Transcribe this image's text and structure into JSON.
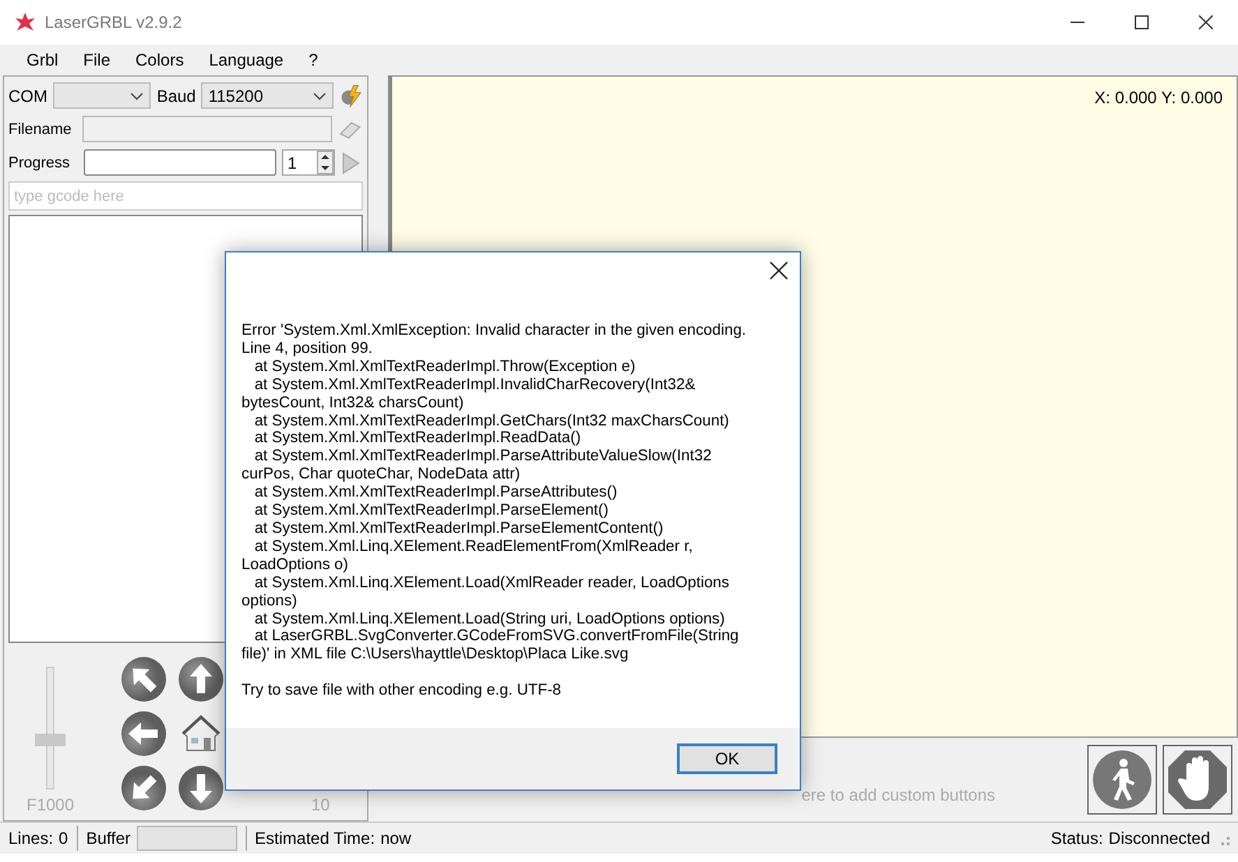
{
  "window": {
    "title": "LaserGRBL v2.9.2"
  },
  "menu": [
    "Grbl",
    "File",
    "Colors",
    "Language",
    "?"
  ],
  "connection": {
    "com_label": "COM",
    "baud_label": "Baud",
    "baud_value": "115200"
  },
  "file": {
    "filename_label": "Filename",
    "progress_label": "Progress",
    "passes": "1"
  },
  "gcode_field": {
    "placeholder": "type gcode here"
  },
  "progress": {
    "level": 0
  },
  "jog": {
    "speed": "F1000",
    "step": "10",
    "speed_slider": {
      "level": 0.4
    }
  },
  "canvas": {
    "coordinates": "X: 0.000 Y: 0.000"
  },
  "custom_buttons": {
    "hint": "ere to add custom buttons"
  },
  "status_bar": {
    "lines_label": "Lines:",
    "lines": "0",
    "buffer_label": "Buffer",
    "estimated_label": "Estimated Time:",
    "estimated": "now",
    "status_label": "Status:",
    "status": "Disconnected"
  },
  "dialog": {
    "message": [
      "Error 'System.Xml.XmlException: Invalid character in the given encoding.",
      "Line 4, position 99.",
      "   at System.Xml.XmlTextReaderImpl.Throw(Exception e)",
      "   at System.Xml.XmlTextReaderImpl.InvalidCharRecovery(Int32&",
      "bytesCount, Int32& charsCount)",
      "   at System.Xml.XmlTextReaderImpl.GetChars(Int32 maxCharsCount)",
      "   at System.Xml.XmlTextReaderImpl.ReadData()",
      "   at System.Xml.XmlTextReaderImpl.ParseAttributeValueSlow(Int32",
      "curPos, Char quoteChar, NodeData attr)",
      "   at System.Xml.XmlTextReaderImpl.ParseAttributes()",
      "   at System.Xml.XmlTextReaderImpl.ParseElement()",
      "   at System.Xml.XmlTextReaderImpl.ParseElementContent()",
      "   at System.Xml.Linq.XElement.ReadElementFrom(XmlReader r,",
      "LoadOptions o)",
      "   at System.Xml.Linq.XElement.Load(XmlReader reader, LoadOptions",
      "options)",
      "   at System.Xml.Linq.XElement.Load(String uri, LoadOptions options)",
      "   at LaserGRBL.SvgConverter.GCodeFromSVG.convertFromFile(String",
      "file)' in XML file C:\\Users\\hayttle\\Desktop\\Placa Like.svg"
    ],
    "hint": "Try to save file with other encoding e.g. UTF-8",
    "button": "OK"
  }
}
